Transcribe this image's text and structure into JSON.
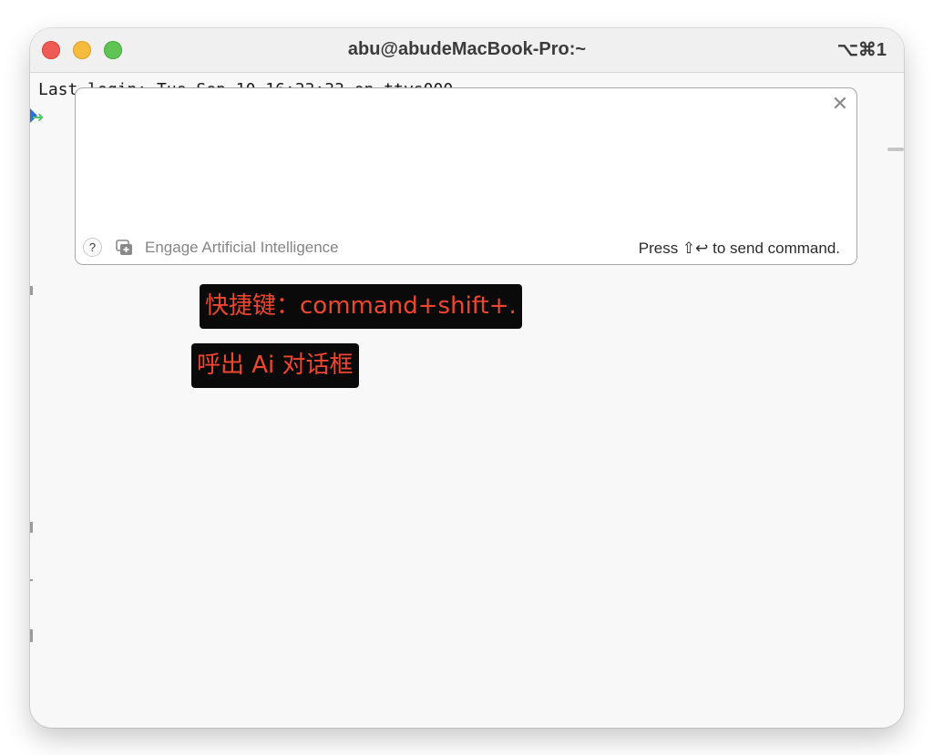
{
  "window": {
    "title": "abu@abudeMacBook-Pro:~",
    "shortcut": "⌥⌘1"
  },
  "terminal": {
    "last_login": "Last login: Tue Sep 10 16:33:33 on ttys000",
    "prompt_symbol": "➜"
  },
  "ai_dialog": {
    "input_value": "",
    "help_label": "?",
    "close_glyph": "✕",
    "engage_label": "Engage Artificial Intelligence",
    "send_hint": "Press ⇧↩ to send command."
  },
  "annotations": {
    "shortcut_note": "快捷键：command+shift+.",
    "open_note": "呼出 Ai 对话框"
  },
  "colors": {
    "annotation_text": "#f0452f",
    "annotation_bg": "#0a0a0a",
    "prompt_green": "#52c56c"
  }
}
